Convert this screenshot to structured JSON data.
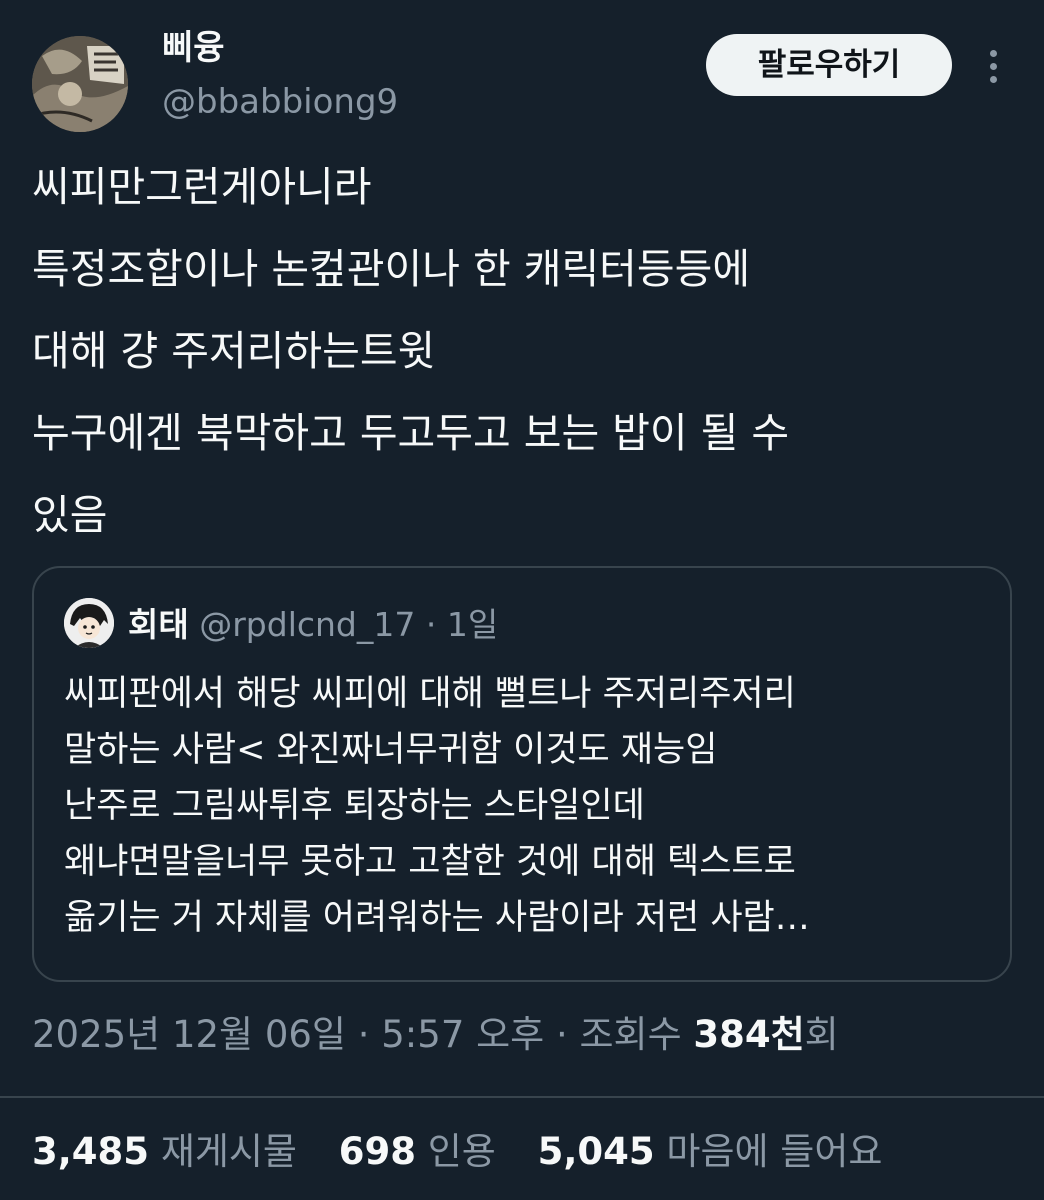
{
  "author": {
    "display_name": "삐융",
    "handle": "@bbabbiong9",
    "avatar_icon": "manga-drawing-avatar-icon"
  },
  "header": {
    "follow_label": "팔로우하기",
    "more_icon": "more-options-icon"
  },
  "tweet": {
    "lines": [
      "씨피만그런게아니라",
      "특정조합이나 논컾관이나 한 캐릭터등등에",
      "대해 걍 주저리하는트윗",
      "누구에겐 북막하고 두고두고 보는 밥이 될 수",
      "있음"
    ]
  },
  "quote": {
    "display_name": "회태",
    "handle": "@rpdlcnd_17",
    "separator": "·",
    "time": "1일",
    "avatar_icon": "cartoon-character-avatar-icon",
    "lines": [
      "씨피판에서 해당 씨피에 대해 뻘트나 주저리주저리",
      "말하는 사람< 와진짜너무귀함 이것도 재능임",
      "난주로 그림싸튀후 퇴장하는 스타일인데",
      "왜냐면말을너무 못하고 고찰한 것에 대해 텍스트로",
      "옮기는 거 자체를 어려워하는 사람이라 저런 사람…"
    ]
  },
  "meta": {
    "date": "2025년 12월 06일",
    "sep1": "·",
    "time": "5:57 오후",
    "sep2": "·",
    "views_label": "조회수",
    "views_value": "384천",
    "views_suffix": "회"
  },
  "stats": {
    "reposts_count": "3,485",
    "reposts_label": "재게시물",
    "quotes_count": "698",
    "quotes_label": "인용",
    "likes_count": "5,045",
    "likes_label": "마음에 들어요"
  },
  "colors": {
    "background": "#15202b",
    "text_primary": "#f7f9f9",
    "text_secondary": "#8b98a5",
    "border": "#38444d",
    "follow_button_bg": "#eff3f4"
  }
}
